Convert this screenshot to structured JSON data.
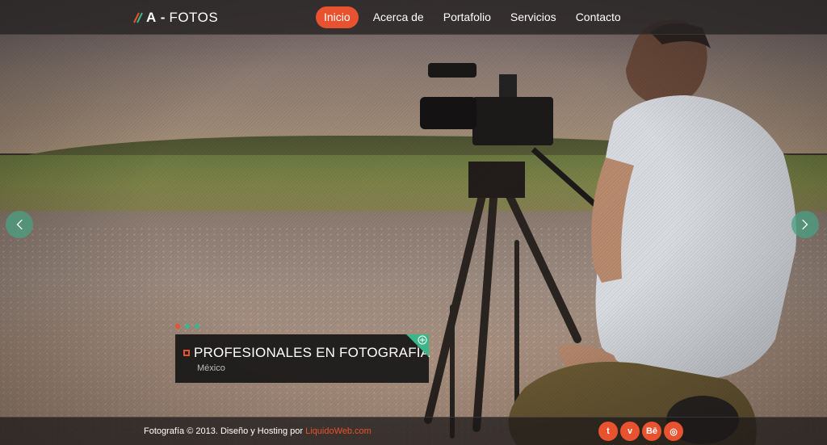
{
  "brand": {
    "mark": "A",
    "separator": "-",
    "name": "FOTOS"
  },
  "nav": {
    "items": [
      {
        "label": "Inicio",
        "active": true
      },
      {
        "label": "Acerca de",
        "active": false
      },
      {
        "label": "Portafolio",
        "active": false
      },
      {
        "label": "Servicios",
        "active": false
      },
      {
        "label": "Contacto",
        "active": false
      }
    ]
  },
  "slider": {
    "caption_title": "PROFESIONALES EN FOTOGRAFÍA",
    "caption_subtitle": "México",
    "dots": [
      "#e9522f",
      "#3bb58a",
      "#3bb58a"
    ],
    "prev_icon": "chevron-left-icon",
    "next_icon": "chevron-right-icon"
  },
  "footer": {
    "text": "Fotografía © 2013. Diseño y Hosting por ",
    "link_label": "LiquidoWeb.com",
    "social": [
      {
        "name": "twitter-icon",
        "glyph": "t"
      },
      {
        "name": "vimeo-icon",
        "glyph": "v"
      },
      {
        "name": "behance-icon",
        "glyph": "Bē"
      },
      {
        "name": "dribbble-icon",
        "glyph": "◎"
      }
    ]
  },
  "colors": {
    "accent": "#e9522f",
    "secondary": "#3bb58a",
    "header_bg": "#282424"
  }
}
